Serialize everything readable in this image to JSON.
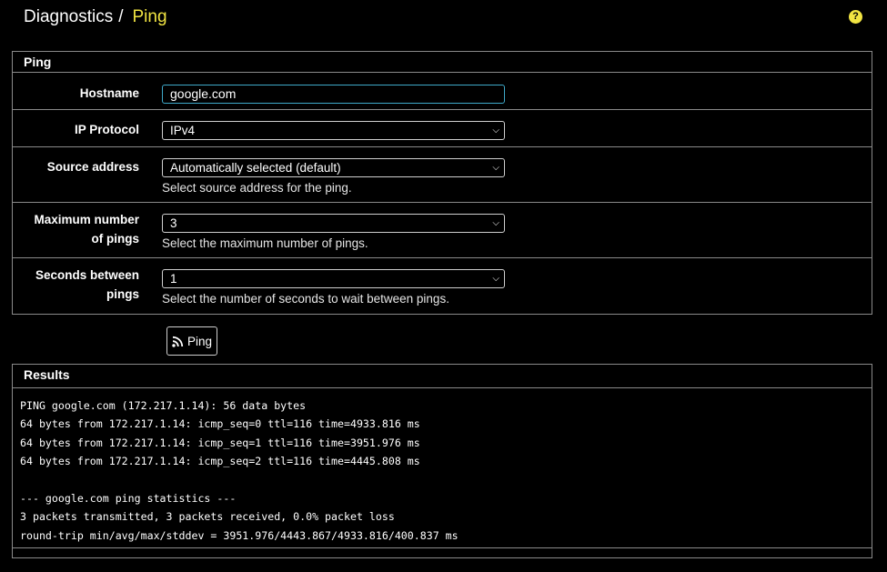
{
  "breadcrumb": {
    "parent": "Diagnostics",
    "separator": "/",
    "current": "Ping"
  },
  "help_icon": "question-circle-icon",
  "ping_panel": {
    "title": "Ping",
    "hostname": {
      "label": "Hostname",
      "value": "google.com"
    },
    "ip_protocol": {
      "label": "IP Protocol",
      "selected": "IPv4"
    },
    "source_address": {
      "label": "Source address",
      "selected": "Automatically selected (default)",
      "help": "Select source address for the ping."
    },
    "max_pings": {
      "label_line1": "Maximum number",
      "label_line2": "of pings",
      "selected": "3",
      "help": "Select the maximum number of pings."
    },
    "seconds_between": {
      "label_line1": "Seconds between",
      "label_line2": "pings",
      "selected": "1",
      "help": "Select the number of seconds to wait between pings."
    }
  },
  "ping_button": {
    "label": "Ping",
    "icon": "rss-icon"
  },
  "results_panel": {
    "title": "Results",
    "lines": [
      "PING google.com (172.217.1.14): 56 data bytes",
      "64 bytes from 172.217.1.14: icmp_seq=0 ttl=116 time=4933.816 ms",
      "64 bytes from 172.217.1.14: icmp_seq=1 ttl=116 time=3951.976 ms",
      "64 bytes from 172.217.1.14: icmp_seq=2 ttl=116 time=4445.808 ms",
      "",
      "--- google.com ping statistics ---",
      "3 packets transmitted, 3 packets received, 0.0% packet loss",
      "round-trip min/avg/max/stddev = 3951.976/4443.867/4933.816/400.837 ms"
    ]
  },
  "colors": {
    "background": "#000000",
    "accent": "#f1e442",
    "border": "#8a8a8a",
    "input_focus": "#3fa9c9"
  }
}
